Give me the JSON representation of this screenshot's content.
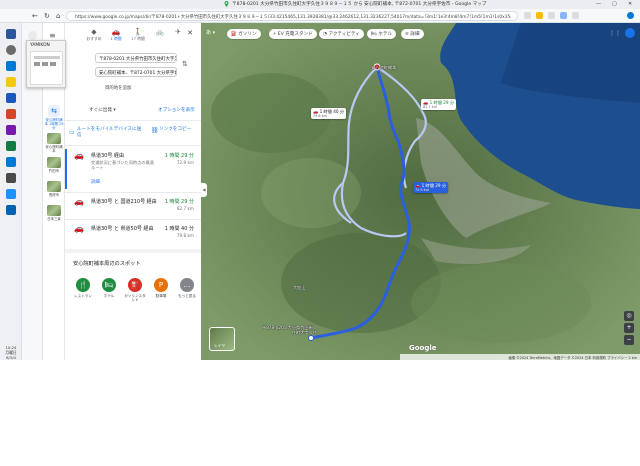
{
  "window": {
    "title": "〒878-0201 大分県竹田市久住町大字久住３９８９－１５ から 安心院町補本, 〒872-0701 大分県宇佐市 - Google マップ"
  },
  "browser": {
    "url": "https://www.google.co.jp/maps/dir/〒878-0201+大分県竹田市久住町大字久住３９８９−１５/33.4215465,131.3928381/@33.2462612,131.3236227,54017m/data=!3m1!1e3!4m8!4m7!1m5!1m1!1s0x3541345"
  },
  "taskbar": {
    "clock_time": "10:24",
    "clock_day": "月曜日",
    "clock_date": "6/3/4"
  },
  "preview": {
    "title": "YAMIKON"
  },
  "rail": {
    "items": [
      {
        "label": "安心院町補本\n1時間 29 分"
      },
      {
        "label": "安心院町補本"
      },
      {
        "label": "竹田市"
      },
      {
        "label": "長府市"
      },
      {
        "label": "日本三景"
      }
    ]
  },
  "modes": {
    "items": [
      {
        "icon": "◆",
        "label": "おすすめ"
      },
      {
        "icon": "🚗",
        "label": "1 時間"
      },
      {
        "icon": "🚶",
        "label": "17 時間"
      },
      {
        "icon": "🚲",
        "label": ""
      },
      {
        "icon": "✈",
        "label": ""
      }
    ]
  },
  "panel": {
    "origin": "〒878-0201 大分県竹田市久住町大字久住",
    "destination": "安心院町補本、〒872-0701 大分県宇佐市",
    "add_destination": "目的地を追加",
    "depart_now": "すぐに出発 ▾",
    "options": "オプションを表示",
    "send_to_mobile": "ルートをモバイルデバイスに送信",
    "copy_link": "リンクをコピー",
    "routes": [
      {
        "name": "県道30号 経由",
        "time": "1 時間 29 分",
        "distance": "72.9 km",
        "note": "交通状況に基づいた同時点の最適ルート",
        "detail": "詳細"
      },
      {
        "name": "県道30号 と 国道210号 経由",
        "time": "1 時間 29 分",
        "distance": "82.7 km",
        "note": "",
        "detail": ""
      },
      {
        "name": "県道30号 と 県道50号 経由",
        "time": "1 時間 40 分",
        "distance": "79.8 km",
        "note": "",
        "detail": ""
      }
    ],
    "nearby_title": "安心院町補本周辺のスポット",
    "nearby": [
      {
        "icon": "🍴",
        "label": "レストラン",
        "color": "#1e8e3e"
      },
      {
        "icon": "🛏",
        "label": "ホテル",
        "color": "#1e8e3e"
      },
      {
        "icon": "⛽",
        "label": "ガソリンスタンド",
        "color": "#d93025"
      },
      {
        "icon": "P",
        "label": "駐車場",
        "color": "#e8710a"
      },
      {
        "icon": "…",
        "label": "もっと見る",
        "color": "#80868b"
      }
    ]
  },
  "map": {
    "lang": "あ ▾",
    "chips": [
      {
        "label": "⛽ ガソリン"
      },
      {
        "label": "⚡ EV 充電スタンド"
      },
      {
        "label": "◔ アクティビティ"
      },
      {
        "label": "🛏 ホテル"
      },
      {
        "label": "≡ 詳細"
      }
    ],
    "badges": [
      {
        "time": "1 時間 40 分",
        "dist": "79.8 km"
      },
      {
        "time": "1 時間 29 分",
        "dist": "82.7 km"
      },
      {
        "time": "1 時間 29 分",
        "dist": "72.9 km"
      }
    ],
    "dest_label": "安心院町補本",
    "origin_label": "〒878-0201 大分県竹田市久住町大字久住",
    "place_label": "大船山",
    "layers": "レイヤ",
    "google": "Google",
    "footer": "画像 ©2024 TerraMetrics、地図データ ©2024 日本 利用規約 プライバシー 2 km"
  },
  "colors": {
    "route_primary": "#2a5fe0",
    "route_alt": "#b9c9f5",
    "link_blue": "#1a73e8",
    "time_green": "#188038"
  }
}
